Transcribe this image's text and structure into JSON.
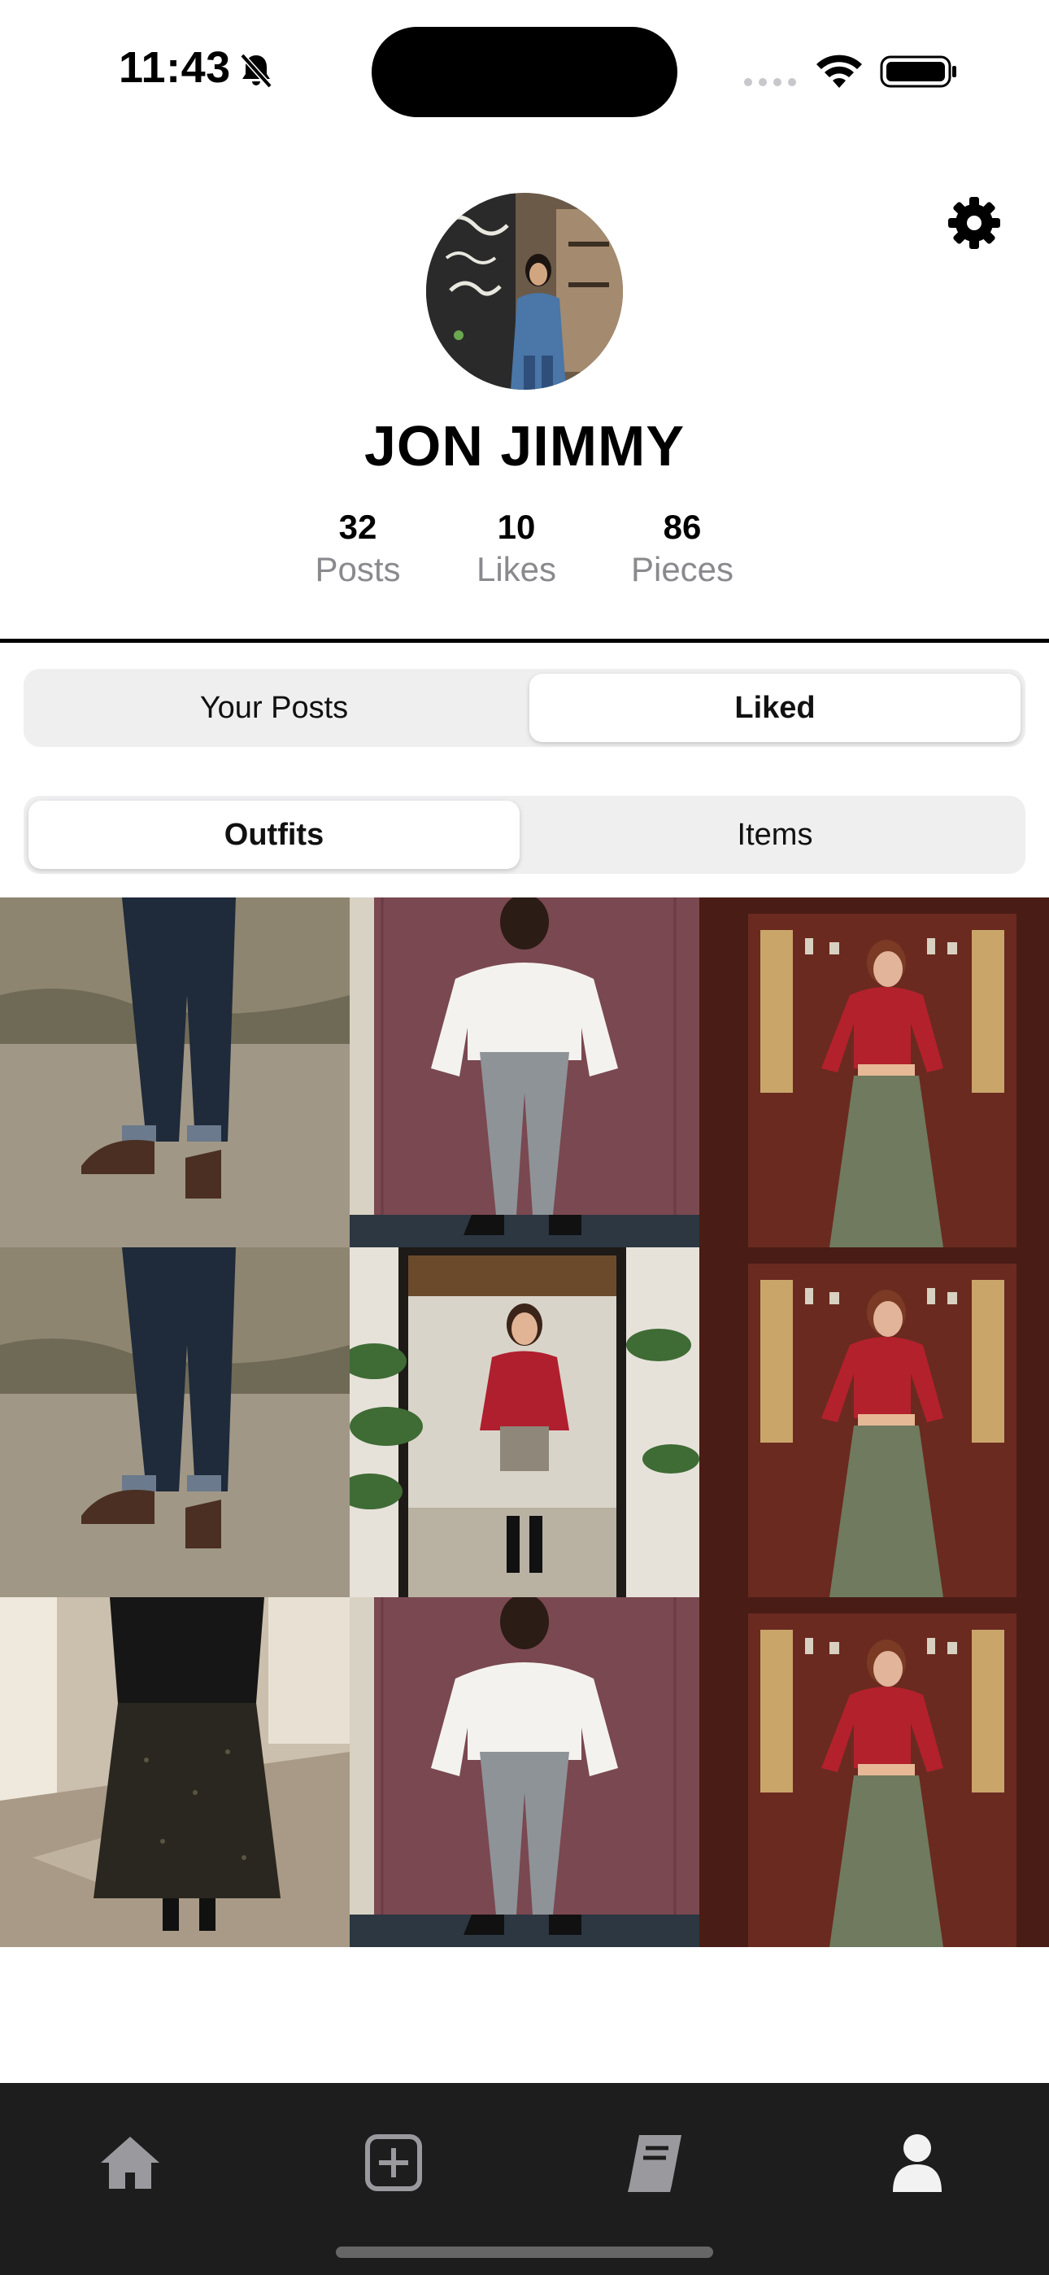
{
  "status_bar": {
    "time": "11:43",
    "icons": [
      "bell-slash-icon",
      "cellular-icon",
      "wifi-icon",
      "battery-icon"
    ]
  },
  "profile": {
    "name": "JON JIMMY",
    "stats": [
      {
        "value": "32",
        "label": "Posts"
      },
      {
        "value": "10",
        "label": "Likes"
      },
      {
        "value": "86",
        "label": "Pieces"
      }
    ]
  },
  "feed_toggle": {
    "left": "Your Posts",
    "right": "Liked",
    "selected": "Liked"
  },
  "type_toggle": {
    "left": "Outfits",
    "right": "Items",
    "selected": "Outfits"
  },
  "grid": [
    {
      "icon": "outfit-jeans-boots-photo"
    },
    {
      "icon": "outfit-white-sweater-photo"
    },
    {
      "icon": "outfit-red-top-skirt-photo"
    },
    {
      "icon": "outfit-jeans-boots-photo"
    },
    {
      "icon": "outfit-mirror-selfie-photo"
    },
    {
      "icon": "outfit-red-top-skirt-photo"
    },
    {
      "icon": "outfit-black-skirt-photo"
    },
    {
      "icon": "outfit-white-sweater-photo"
    },
    {
      "icon": "outfit-red-top-skirt-photo"
    }
  ],
  "tab_bar": {
    "items": [
      "home-icon",
      "add-post-icon",
      "lookbook-icon",
      "profile-icon"
    ],
    "active": "profile-icon"
  },
  "colors": {
    "tab_bar_bg": "#1d1d1e",
    "segment_bg": "#efeff0",
    "stat_label": "#8a8a8e",
    "divider": "#000000"
  }
}
